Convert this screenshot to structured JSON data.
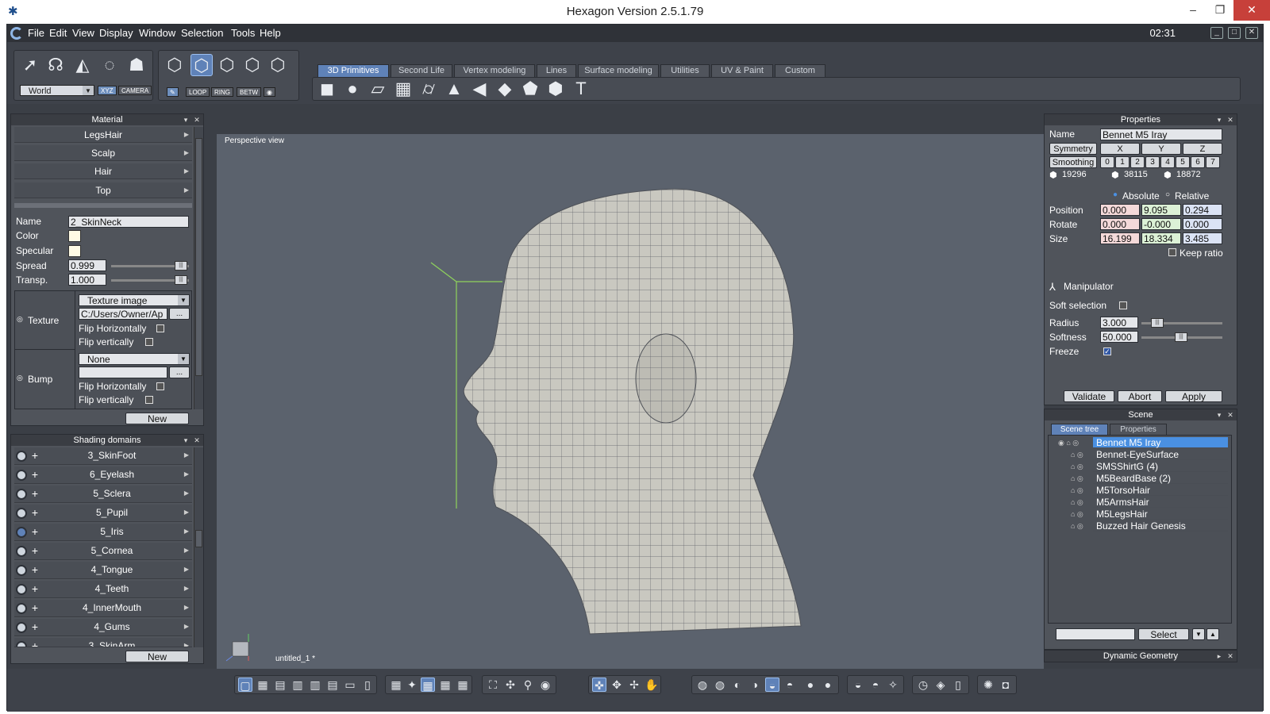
{
  "window": {
    "title": "Hexagon Version 2.5.1.79",
    "controls": [
      "–",
      "❐",
      "✕"
    ]
  },
  "menubar": {
    "items": [
      "File",
      "Edit",
      "View",
      "Display",
      "Window",
      "Selection",
      "Tools",
      "Help"
    ],
    "clock": "02:31"
  },
  "toolbar": {
    "world_label": "World",
    "xyz": "XYZ",
    "camera": "CAMERA",
    "loop": "LOOP",
    "ring": "RING",
    "betw": "BETW",
    "tabs": [
      "3D Primitives",
      "Second Life",
      "Vertex modeling",
      "Lines",
      "Surface modeling",
      "Utilities",
      "UV & Paint",
      "Custom"
    ],
    "active_tab": "3D Primitives"
  },
  "material_panel": {
    "title": "Material",
    "items": [
      "LegsHair",
      "Scalp",
      "Hair",
      "Top"
    ],
    "name_label": "Name",
    "name_value": "2_SkinNeck",
    "color_label": "Color",
    "specular_label": "Specular",
    "spread_label": "Spread",
    "spread_value": "0.999",
    "transp_label": "Transp.",
    "transp_value": "1.000",
    "texture_label": "Texture",
    "texture_type": "Texture image",
    "texture_path": "C:/Users/Owner/Ap",
    "flip_h": "Flip Horizontally",
    "flip_v": "Flip vertically",
    "bump_label": "Bump",
    "bump_type": "None",
    "browse": "...",
    "new_button": "New"
  },
  "shading_panel": {
    "title": "Shading domains",
    "items": [
      "3_SkinFoot",
      "6_Eyelash",
      "5_Sclera",
      "5_Pupil",
      "5_Iris",
      "5_Cornea",
      "4_Tongue",
      "4_Teeth",
      "4_InnerMouth",
      "4_Gums",
      "3_SkinArm"
    ],
    "new_button": "New"
  },
  "viewport": {
    "label": "Perspective view",
    "file": "untitled_1 *"
  },
  "properties_panel": {
    "title": "Properties",
    "name_label": "Name",
    "name_value": "Bennet M5 Iray",
    "symmetry": "Symmetry",
    "sym_axes": [
      "X",
      "Y",
      "Z"
    ],
    "smoothing": "Smoothing",
    "smooth_levels": [
      "0",
      "1",
      "2",
      "3",
      "4",
      "5",
      "6",
      "7"
    ],
    "counts": [
      "19296",
      "38115",
      "18872"
    ],
    "absolute": "Absolute",
    "relative": "Relative",
    "position_label": "Position",
    "position": [
      "0.000",
      "9.095",
      "0.294"
    ],
    "rotate_label": "Rotate",
    "rotate": [
      "0.000",
      "-0.000",
      "0.000"
    ],
    "size_label": "Size",
    "size": [
      "16.199",
      "18.334",
      "3.485"
    ],
    "keep_ratio": "Keep ratio",
    "manipulator": "Manipulator",
    "soft_selection": "Soft selection",
    "radius_label": "Radius",
    "radius_value": "3.000",
    "softness_label": "Softness",
    "softness_value": "50.000",
    "freeze_label": "Freeze",
    "validate": "Validate",
    "abort": "Abort",
    "apply": "Apply"
  },
  "scene_panel": {
    "title": "Scene",
    "tabs": [
      "Scene tree",
      "Properties"
    ],
    "items": [
      "Bennet M5 Iray",
      "Bennet-EyeSurface",
      "SMSShirtG (4)",
      "M5BeardBase (2)",
      "M5TorsoHair",
      "M5ArmsHair",
      "M5LegsHair",
      "Buzzed Hair Genesis"
    ],
    "selected": "Bennet M5 Iray",
    "select_button": "Select"
  },
  "dynamic_geometry": {
    "title": "Dynamic Geometry"
  }
}
